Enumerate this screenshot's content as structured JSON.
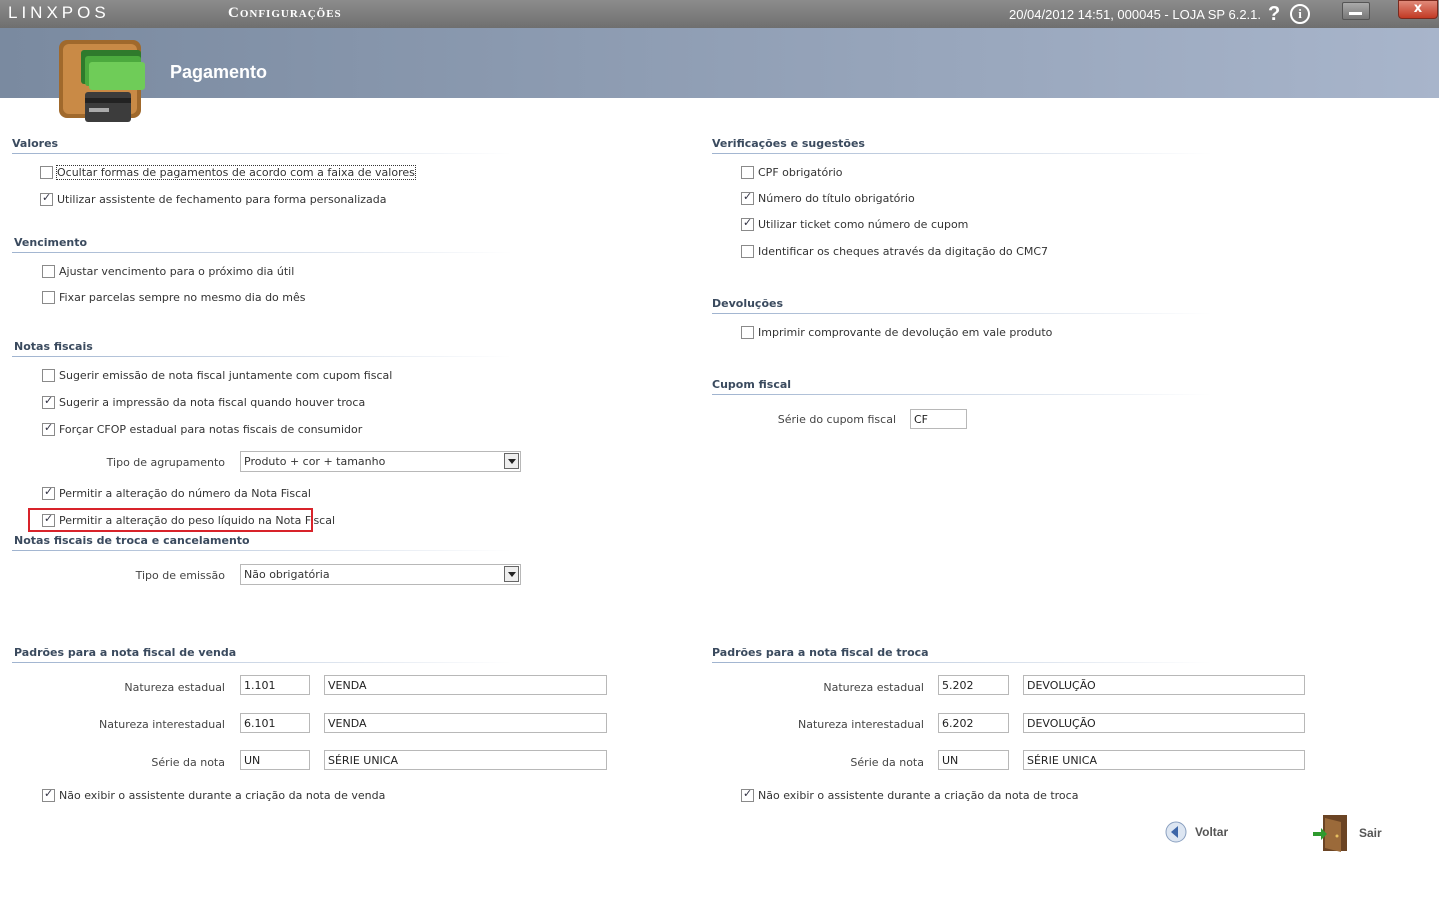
{
  "titlebar": {
    "logo": "LINXPOS",
    "module": "Configurações",
    "status": "20/04/2012 14:51, 000045 - LOJA SP 6.2.1.",
    "help": "?",
    "info": "i",
    "close": "x"
  },
  "header": {
    "title": "Pagamento"
  },
  "valores": {
    "title": "Valores",
    "items": [
      {
        "label": "Ocultar formas de pagamentos de acordo com a faixa de valores",
        "checked": false
      },
      {
        "label": "Utilizar assistente de fechamento para forma personalizada",
        "checked": true
      }
    ]
  },
  "vencimento": {
    "title": "Vencimento",
    "items": [
      {
        "label": "Ajustar vencimento para o próximo dia útil",
        "checked": false
      },
      {
        "label": "Fixar parcelas sempre no mesmo dia do mês",
        "checked": false
      }
    ]
  },
  "notas": {
    "title": "Notas fiscais",
    "items": [
      {
        "label": "Sugerir emissão de nota fiscal juntamente com cupom fiscal",
        "checked": false
      },
      {
        "label": "Sugerir a impressão da nota fiscal quando houver troca",
        "checked": true
      },
      {
        "label": "Forçar CFOP estadual para notas fiscais de consumidor",
        "checked": true
      }
    ],
    "agrupamento_label": "Tipo de agrupamento",
    "agrupamento_value": "Produto + cor + tamanho",
    "items2": [
      {
        "label": "Permitir a alteração do número da Nota Fiscal",
        "checked": true
      },
      {
        "label": "Permitir a alteração do peso líquido na Nota Fiscal",
        "checked": true
      }
    ]
  },
  "troca_cancel": {
    "title": "Notas fiscais de troca e cancelamento",
    "emissao_label": "Tipo de emissão",
    "emissao_value": "Não obrigatória"
  },
  "verificacoes": {
    "title": "Verificações e sugestões",
    "items": [
      {
        "label": "CPF obrigatório",
        "checked": false
      },
      {
        "label": "Número do título obrigatório",
        "checked": true
      },
      {
        "label": "Utilizar ticket como número de cupom",
        "checked": true
      },
      {
        "label": "Identificar os cheques através da digitação do CMC7",
        "checked": false
      }
    ]
  },
  "devolucoes": {
    "title": "Devoluções",
    "items": [
      {
        "label": "Imprimir comprovante de devolução em vale produto",
        "checked": false
      }
    ]
  },
  "cupom": {
    "title": "Cupom fiscal",
    "serie_label": "Série do cupom fiscal",
    "serie_value": "CF"
  },
  "venda": {
    "title": "Padrões para a nota fiscal de venda",
    "rows": [
      {
        "label": "Natureza estadual",
        "code": "1.101",
        "desc": "VENDA"
      },
      {
        "label": "Natureza interestadual",
        "code": "6.101",
        "desc": "VENDA"
      },
      {
        "label": "Série da nota",
        "code": "UN",
        "desc": "SÉRIE UNICA"
      }
    ],
    "assist": {
      "label": "Não exibir o assistente durante a criação da nota de venda",
      "checked": true
    }
  },
  "troca": {
    "title": "Padrões para a nota fiscal de troca",
    "rows": [
      {
        "label": "Natureza estadual",
        "code": "5.202",
        "desc": "DEVOLUÇÃO"
      },
      {
        "label": "Natureza interestadual",
        "code": "6.202",
        "desc": "DEVOLUÇÃO"
      },
      {
        "label": "Série da nota",
        "code": "UN",
        "desc": "SÉRIE UNICA"
      }
    ],
    "assist": {
      "label": "Não exibir o assistente durante a criação da nota de troca",
      "checked": true
    }
  },
  "footer": {
    "back": "Voltar",
    "exit": "Sair"
  }
}
